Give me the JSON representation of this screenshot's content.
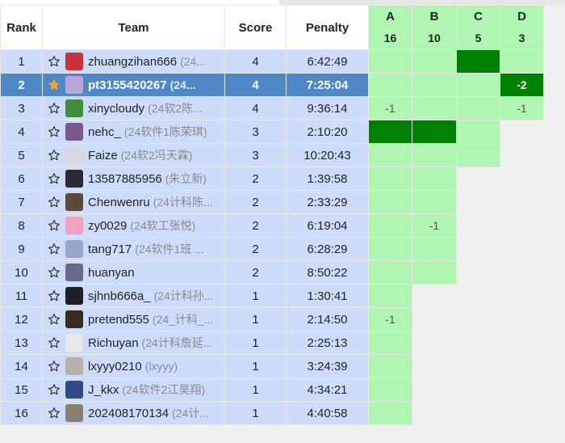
{
  "headers": {
    "rank": "Rank",
    "team": "Team",
    "score": "Score",
    "penalty": "Penalty"
  },
  "problems": [
    {
      "letter": "A",
      "count": "16"
    },
    {
      "letter": "B",
      "count": "10"
    },
    {
      "letter": "C",
      "count": "5"
    },
    {
      "letter": "D",
      "count": "3"
    }
  ],
  "colors": {
    "accepted": "#b0f5b2",
    "first_blood": "#008000",
    "row_bg": "#cedcfc",
    "highlight_row": "#4e88c6",
    "star_filled": "#f5a623"
  },
  "rows": [
    {
      "rank": "1",
      "name": "zhuangzihan666",
      "sub": "(24...",
      "score": "4",
      "penalty": "6:42:49",
      "starred": false,
      "avatar": "#c8323c",
      "cells": [
        {
          "state": "ac",
          "text": ""
        },
        {
          "state": "ac",
          "text": ""
        },
        {
          "state": "fb",
          "text": ""
        },
        {
          "state": "ac",
          "text": ""
        }
      ]
    },
    {
      "rank": "2",
      "name": "pt3155420267",
      "sub": "(24...",
      "score": "4",
      "penalty": "7:25:04",
      "starred": true,
      "highlight": true,
      "avatar": "#b9a6d8",
      "cells": [
        {
          "state": "ac",
          "text": ""
        },
        {
          "state": "ac",
          "text": ""
        },
        {
          "state": "ac",
          "text": ""
        },
        {
          "state": "fb",
          "text": "-2"
        }
      ]
    },
    {
      "rank": "3",
      "name": "xinycloudy",
      "sub": "(24软2陈...",
      "score": "4",
      "penalty": "9:36:14",
      "starred": false,
      "avatar": "#3f8f3a",
      "cells": [
        {
          "state": "ac",
          "text": "-1"
        },
        {
          "state": "ac",
          "text": ""
        },
        {
          "state": "ac",
          "text": ""
        },
        {
          "state": "ac",
          "text": "-1"
        }
      ]
    },
    {
      "rank": "4",
      "name": "nehc_",
      "sub": "(24软件1陈荣琪)",
      "score": "3",
      "penalty": "2:10:20",
      "starred": false,
      "avatar": "#7a5a8a",
      "cells": [
        {
          "state": "fb",
          "text": ""
        },
        {
          "state": "fb",
          "text": ""
        },
        {
          "state": "ac",
          "text": ""
        },
        {
          "state": "none",
          "text": ""
        }
      ]
    },
    {
      "rank": "5",
      "name": "Faize",
      "sub": "(24软2冯天霖)",
      "score": "3",
      "penalty": "10:20:43",
      "starred": false,
      "avatar": "#d8d8e0",
      "cells": [
        {
          "state": "ac",
          "text": ""
        },
        {
          "state": "ac",
          "text": ""
        },
        {
          "state": "ac",
          "text": ""
        },
        {
          "state": "none",
          "text": ""
        }
      ]
    },
    {
      "rank": "6",
      "name": "13587885956",
      "sub": "(朱立新)",
      "score": "2",
      "penalty": "1:39:58",
      "starred": false,
      "avatar": "#2a2a34",
      "cells": [
        {
          "state": "ac",
          "text": ""
        },
        {
          "state": "ac",
          "text": ""
        },
        {
          "state": "none",
          "text": ""
        },
        {
          "state": "none",
          "text": ""
        }
      ]
    },
    {
      "rank": "7",
      "name": "Chenwenru",
      "sub": "(24计科陈...",
      "score": "2",
      "penalty": "2:33:29",
      "starred": false,
      "avatar": "#5a4a3a",
      "cells": [
        {
          "state": "ac",
          "text": ""
        },
        {
          "state": "ac",
          "text": ""
        },
        {
          "state": "none",
          "text": ""
        },
        {
          "state": "none",
          "text": ""
        }
      ]
    },
    {
      "rank": "8",
      "name": "zy0029",
      "sub": "(24软工张悦)",
      "score": "2",
      "penalty": "6:19:04",
      "starred": false,
      "avatar": "#f2a2c0",
      "cells": [
        {
          "state": "ac",
          "text": ""
        },
        {
          "state": "ac",
          "text": "-1"
        },
        {
          "state": "none",
          "text": ""
        },
        {
          "state": "none",
          "text": ""
        }
      ]
    },
    {
      "rank": "9",
      "name": "tang717",
      "sub": "(24软件1班 ...",
      "score": "2",
      "penalty": "6:28:29",
      "starred": false,
      "avatar": "#9aa6c8",
      "cells": [
        {
          "state": "ac",
          "text": ""
        },
        {
          "state": "ac",
          "text": ""
        },
        {
          "state": "none",
          "text": ""
        },
        {
          "state": "none",
          "text": ""
        }
      ]
    },
    {
      "rank": "10",
      "name": "huanyan",
      "sub": "",
      "score": "2",
      "penalty": "8:50:22",
      "starred": false,
      "avatar": "#6a6a8a",
      "cells": [
        {
          "state": "ac",
          "text": ""
        },
        {
          "state": "ac",
          "text": ""
        },
        {
          "state": "none",
          "text": ""
        },
        {
          "state": "none",
          "text": ""
        }
      ]
    },
    {
      "rank": "11",
      "name": "sjhnb666a_",
      "sub": "(24计科孙...",
      "score": "1",
      "penalty": "1:30:41",
      "starred": false,
      "avatar": "#1e1e24",
      "cells": [
        {
          "state": "ac",
          "text": ""
        },
        {
          "state": "none",
          "text": ""
        },
        {
          "state": "none",
          "text": ""
        },
        {
          "state": "none",
          "text": ""
        }
      ]
    },
    {
      "rank": "12",
      "name": "pretend555",
      "sub": "(24_计科_...",
      "score": "1",
      "penalty": "2:14:50",
      "starred": false,
      "avatar": "#3a2a20",
      "cells": [
        {
          "state": "ac",
          "text": "-1"
        },
        {
          "state": "none",
          "text": ""
        },
        {
          "state": "none",
          "text": ""
        },
        {
          "state": "none",
          "text": ""
        }
      ]
    },
    {
      "rank": "13",
      "name": "Richuyan",
      "sub": "(24计科詹延...",
      "score": "1",
      "penalty": "2:25:13",
      "starred": false,
      "avatar": "#e8e8e8",
      "cells": [
        {
          "state": "ac",
          "text": ""
        },
        {
          "state": "none",
          "text": ""
        },
        {
          "state": "none",
          "text": ""
        },
        {
          "state": "none",
          "text": ""
        }
      ]
    },
    {
      "rank": "14",
      "name": "lxyyy0210",
      "sub": "(lxyyy)",
      "score": "1",
      "penalty": "3:24:39",
      "starred": false,
      "avatar": "#b8b0a8",
      "cells": [
        {
          "state": "ac",
          "text": ""
        },
        {
          "state": "none",
          "text": ""
        },
        {
          "state": "none",
          "text": ""
        },
        {
          "state": "none",
          "text": ""
        }
      ]
    },
    {
      "rank": "15",
      "name": "J_kkx",
      "sub": "(24软件2江昊翔)",
      "score": "1",
      "penalty": "4:34:21",
      "starred": false,
      "avatar": "#2f4a86",
      "cells": [
        {
          "state": "ac",
          "text": ""
        },
        {
          "state": "none",
          "text": ""
        },
        {
          "state": "none",
          "text": ""
        },
        {
          "state": "none",
          "text": ""
        }
      ]
    },
    {
      "rank": "16",
      "name": "202408170134",
      "sub": "(24计...",
      "score": "1",
      "penalty": "4:40:58",
      "starred": false,
      "avatar": "#8a8070",
      "cells": [
        {
          "state": "ac",
          "text": ""
        },
        {
          "state": "none",
          "text": ""
        },
        {
          "state": "none",
          "text": ""
        },
        {
          "state": "none",
          "text": ""
        }
      ]
    }
  ]
}
